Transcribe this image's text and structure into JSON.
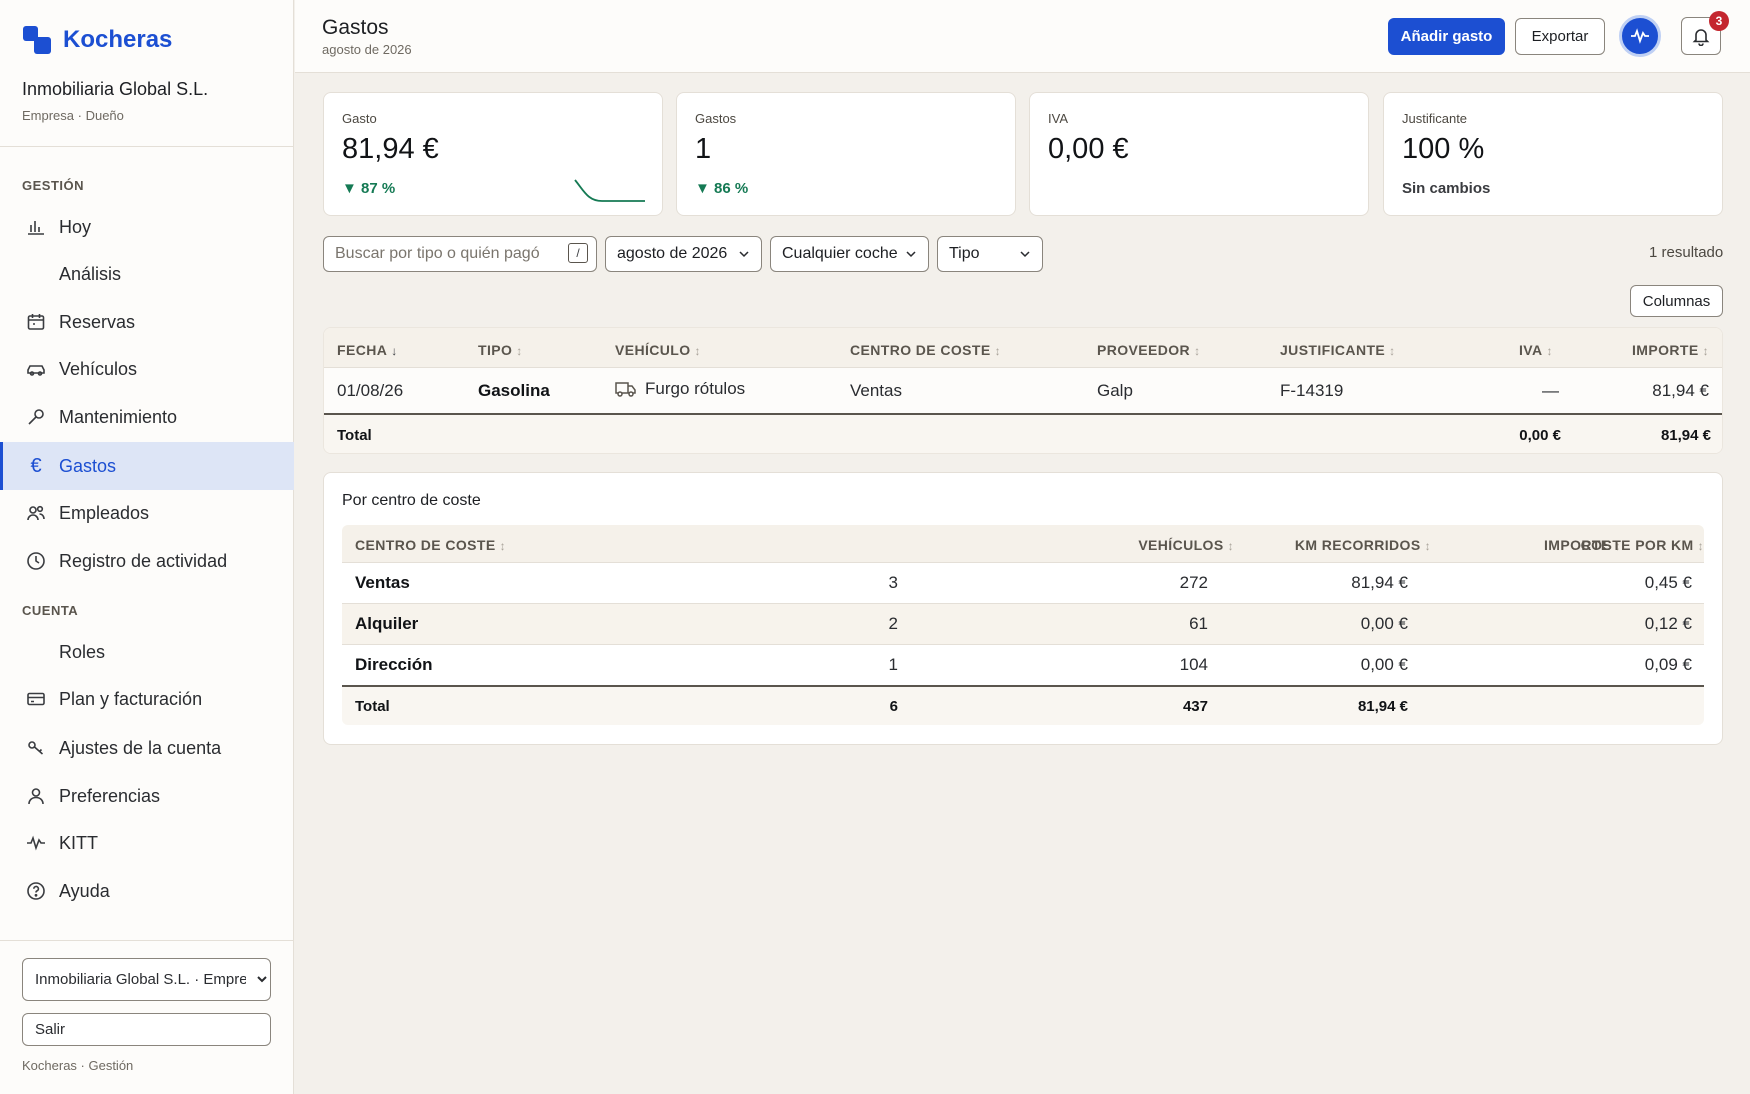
{
  "brand": {
    "name": "Kocheras"
  },
  "company": {
    "name": "Inmobiliaria Global S.L.",
    "subtitle": "Empresa · Dueño"
  },
  "sidebar": {
    "section_management": "GESTIÓN",
    "section_account": "CUENTA",
    "items": [
      {
        "label": "Hoy",
        "icon": "bar-chart-icon"
      },
      {
        "label": "Análisis",
        "icon": ""
      },
      {
        "label": "Reservas",
        "icon": "calendar-icon"
      },
      {
        "label": "Vehículos",
        "icon": "car-icon"
      },
      {
        "label": "Mantenimiento",
        "icon": "wrench-icon"
      },
      {
        "label": "Gastos",
        "icon": "euro-icon",
        "active": true
      },
      {
        "label": "Empleados",
        "icon": "users-icon"
      },
      {
        "label": "Registro de actividad",
        "icon": "clock-icon"
      },
      {
        "label": "Roles",
        "icon": ""
      },
      {
        "label": "Plan y facturación",
        "icon": "credit-card-icon"
      },
      {
        "label": "Ajustes de la cuenta",
        "icon": "key-icon"
      },
      {
        "label": "Preferencias",
        "icon": "user-icon"
      },
      {
        "label": "KITT",
        "icon": "pulse-icon"
      },
      {
        "label": "Ayuda",
        "icon": "help-icon"
      }
    ],
    "org_selector_value": "Inmobiliaria Global S.L. · Empresa",
    "logout_label": "Salir",
    "footer": "Kocheras · Gestión"
  },
  "header": {
    "title": "Gastos",
    "subtitle": "agosto de 2026",
    "add_label": "Añadir gasto",
    "export_label": "Exportar",
    "notifications_count": "3"
  },
  "kpis": [
    {
      "label": "Gasto",
      "value": "81,94 €",
      "delta": "87 %",
      "trend": "down"
    },
    {
      "label": "Gastos",
      "value": "1",
      "delta": "86 %",
      "trend": "down"
    },
    {
      "label": "IVA",
      "value": "0,00 €",
      "delta": ""
    },
    {
      "label": "Justificante",
      "value": "100 %",
      "delta": "Sin cambios"
    }
  ],
  "filters": {
    "search_placeholder": "Buscar por tipo o quién pagó",
    "search_shortcut": "/",
    "month": "agosto de 2026",
    "car": "Cualquier coche",
    "type": "Tipo",
    "result_count": "1 resultado",
    "columns_label": "Columnas"
  },
  "expenses": {
    "headers": {
      "date": "FECHA",
      "type": "TIPO",
      "vehicle": "VEHÍCULO",
      "cost_center": "CENTRO DE COSTE",
      "supplier": "PROVEEDOR",
      "receipt": "JUSTIFICANTE",
      "vat": "IVA",
      "amount": "IMPORTE"
    },
    "rows": [
      {
        "date": "01/08/26",
        "type": "Gasolina",
        "vehicle": "Furgo rótulos",
        "cost_center": "Ventas",
        "supplier": "Galp",
        "receipt": "F-14319",
        "vat": "—",
        "amount": "81,94 €"
      }
    ],
    "total": {
      "label": "Total",
      "vat": "0,00 €",
      "amount": "81,94 €"
    }
  },
  "cost_centers": {
    "title": "Por centro de coste",
    "headers": {
      "center": "CENTRO DE COSTE",
      "vehicles": "VEHÍCULOS",
      "km": "KM RECORRIDOS",
      "amount": "IMPORTE",
      "cost_per_km": "COSTE POR KM"
    },
    "rows": [
      {
        "center": "Ventas",
        "vehicles": "3",
        "km": "272",
        "amount": "81,94 €",
        "cost_per_km": "0,45 €"
      },
      {
        "center": "Alquiler",
        "vehicles": "2",
        "km": "61",
        "amount": "0,00 €",
        "cost_per_km": "0,12 €"
      },
      {
        "center": "Dirección",
        "vehicles": "1",
        "km": "104",
        "amount": "0,00 €",
        "cost_per_km": "0,09 €"
      }
    ],
    "total": {
      "label": "Total",
      "vehicles": "6",
      "km": "437",
      "amount": "81,94 €"
    }
  },
  "colors": {
    "accent": "#1c4fd2",
    "positive": "#157a54",
    "badge": "#c4262e"
  }
}
